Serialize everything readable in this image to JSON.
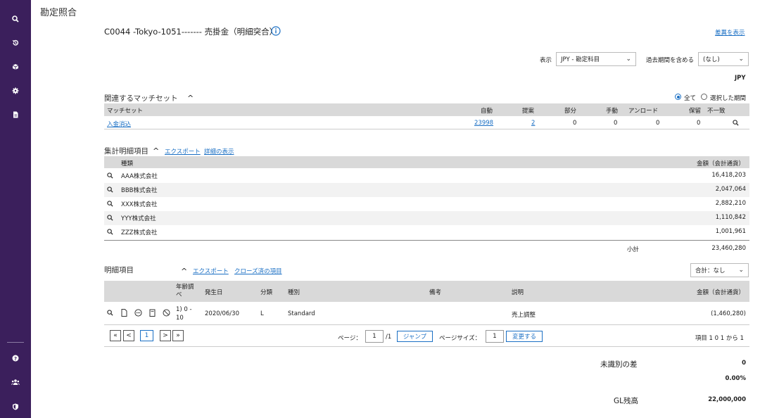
{
  "page_title": "勘定照合",
  "account_title": "C0044 -Tokyo-1051------- 売掛金（明細突合）",
  "show_diff_link": "差異を表示",
  "display": {
    "label": "表示",
    "value": "JPY - 勘定科目",
    "past_label": "過去期間を含める",
    "past_value": "(なし)",
    "currency": "JPY"
  },
  "match_sets": {
    "title": "関連するマッチセット",
    "radio_all": "全て",
    "radio_selected": "選択した期間",
    "columns": [
      "マッチセット",
      "自動",
      "提案",
      "部分",
      "手動",
      "アンロード",
      "保留",
      "不一致"
    ],
    "row": {
      "name": "入金消込",
      "auto": "23998",
      "proposal": "2",
      "partial": "0",
      "manual": "0",
      "unload": "0",
      "hold": "0"
    }
  },
  "summary": {
    "title": "集計明細項目",
    "export": "エクスポート",
    "details": "詳細の表示",
    "col_type": "種類",
    "col_amount": "金額（会計通貨）",
    "rows": [
      {
        "name": "AAA株式会社",
        "amount": "16,418,203"
      },
      {
        "name": "BBB株式会社",
        "amount": "2,047,064"
      },
      {
        "name": "XXX株式会社",
        "amount": "2,882,210"
      },
      {
        "name": "YYY株式会社",
        "amount": "1,110,842"
      },
      {
        "name": "ZZZ株式会社",
        "amount": "1,001,961"
      }
    ],
    "subtotal_label": "小計",
    "subtotal_value": "23,460,280"
  },
  "detail": {
    "title": "明細項目",
    "export": "エクスポート",
    "closed": "クローズ済の項目",
    "total_select": "合計：なし",
    "columns": {
      "age": "年齢調べ",
      "date": "発生日",
      "class": "分類",
      "kind": "種別",
      "note": "備考",
      "desc": "説明",
      "amount": "金額（会計通貨）"
    },
    "row": {
      "age_line1": "1) 0 -",
      "age_line2": "10",
      "date": "2020/06/30",
      "class": "L",
      "kind": "Standard",
      "note": "",
      "desc": "売上調整",
      "amount": "(1,460,280)"
    }
  },
  "pagination": {
    "first": "«",
    "prev": "<",
    "current": "1",
    "next": ">",
    "last": "»",
    "page_label": "ページ：",
    "page_value": "1",
    "page_total": "/1",
    "jump": "ジャンプ",
    "size_label": "ページサイズ：",
    "size_value": "1",
    "change": "変更する",
    "range": "項目 1 0 1 から 1"
  },
  "footer": {
    "unidentified_label": "未識別の差",
    "unidentified_value": "0",
    "percent": "0.00%",
    "gl_label": "GL残高",
    "gl_value": "22,000,000"
  },
  "sidebar": {
    "icons": [
      "search-icon",
      "history-icon",
      "cube-icon",
      "gear-icon",
      "document-icon",
      "help-icon",
      "users-icon",
      "shield-icon"
    ]
  },
  "colors": {
    "sidebar": "#3b1f5c",
    "link": "#1a6fc4",
    "header_bar": "#d9d9d9"
  }
}
